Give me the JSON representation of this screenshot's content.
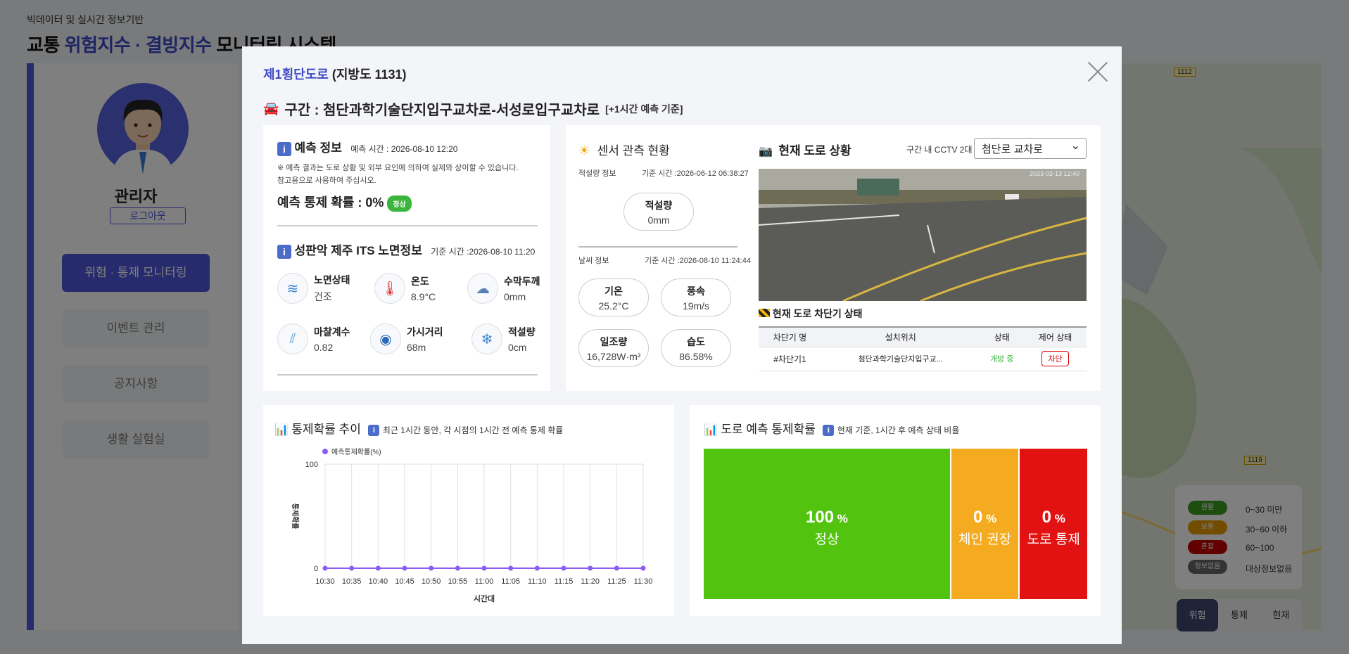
{
  "header": {
    "subtitle": "빅데이터 및 실시간 정보기반",
    "title_pre": "교통 ",
    "title_hl": "위험지수 · 결빙지수",
    "title_post": " 모니터링 시스템"
  },
  "sidebar": {
    "user": "관리자",
    "logout": "로그아웃",
    "menu": [
      "위험 · 통제 모니터링",
      "이벤트 관리",
      "공지사항",
      "생활 실험실"
    ]
  },
  "map": {
    "labels": [
      "1112",
      "1119"
    ],
    "legend": [
      {
        "tag": "원활",
        "text": "0~30 미만",
        "color": "#3a9a1e"
      },
      {
        "tag": "보통",
        "text": "30~60 이하",
        "color": "#e59a00"
      },
      {
        "tag": "혼잡",
        "text": "60~100",
        "color": "#c50000"
      },
      {
        "tag": "정보없음",
        "text": "대상정보없음",
        "color": "#666666"
      }
    ],
    "tabs": [
      "위험",
      "통제",
      "현재"
    ]
  },
  "modal": {
    "road_name": "제1횡단도로",
    "road_code": "(지방도 1131)",
    "section_label": "구간 : 첨단과학기술단지입구교차로-서성로입구교차로",
    "section_suffix": "[+1시간 예측 기준]",
    "forecast": {
      "title": "예측 정보",
      "time": "예측 시간 : 2026-08-10 12:20",
      "note1": "※ 예측 결과는 도로 상황 및 외부 요인에 의하여 실제와 상이할 수 있습니다.",
      "note2": "참고용으로 사용하여 주십시오.",
      "prob_label": "예측 통제 확률 : ",
      "prob_value": "0%",
      "badge": "정상"
    },
    "its": {
      "title": "성판악 제주 ITS 노면정보",
      "time": "기준 시간 :2026-08-10 11:20",
      "items": [
        {
          "label": "노면상태",
          "value": "건조",
          "icon": "wind-icon"
        },
        {
          "label": "온도",
          "value": "8.9°C",
          "icon": "thermometer-icon"
        },
        {
          "label": "수막두께",
          "value": "0mm",
          "icon": "rain-cloud-icon"
        },
        {
          "label": "마찰계수",
          "value": "0.82",
          "icon": "friction-icon"
        },
        {
          "label": "가시거리",
          "value": "68m",
          "icon": "eye-icon"
        },
        {
          "label": "적설량",
          "value": "0cm",
          "icon": "snow-cloud-icon"
        }
      ]
    },
    "sensor": {
      "title": "센서 관측 현황",
      "snow_info": "적설량 정보",
      "snow_time": "기준 시간 :2026-06-12 06:38:27",
      "snow_label": "적설량",
      "snow_value": "0mm",
      "weather_info": "날씨 정보",
      "weather_time": "기준 시간 :2026-08-10 11:24:44",
      "weather": [
        {
          "label": "기온",
          "value": "25.2°C"
        },
        {
          "label": "풍속",
          "value": "19m/s"
        },
        {
          "label": "일조량",
          "value": "16,728W·m²"
        },
        {
          "label": "습도",
          "value": "86.58%"
        }
      ]
    },
    "road": {
      "title": "현재 도로 상황",
      "cctv_count": "구간 내 CCTV 2대",
      "cctv_select": "첨단로 교차로",
      "cctv_timestamp": "2023-02-13 12:40",
      "barrier_title": "현재 도로 차단기 상태",
      "columns": [
        "차단기 명",
        "설치위치",
        "상태",
        "제어 상태"
      ],
      "rows": [
        {
          "name": "#차단기1",
          "location": "첨단과학기술단지입구교...",
          "status": "개방 중",
          "control": "차단"
        }
      ]
    },
    "trend": {
      "title": "통제확률 추이",
      "desc": "최근 1시간 동안, 각 시점의 1시간 전 예측 통제 확률"
    },
    "predict": {
      "title": "도로 예측 통제확률",
      "desc": "현재 기준, 1시간 후 예측 상태 비율",
      "bars": [
        {
          "pct": "100",
          "unit": "%",
          "label": "정상",
          "color": "#52c40f",
          "share": 64.2
        },
        {
          "pct": "0",
          "unit": "%",
          "label": "체인 권장",
          "color": "#f5ab1f",
          "share": 17.9
        },
        {
          "pct": "0",
          "unit": "%",
          "label": "도로 통제",
          "color": "#e31212",
          "share": 17.9
        }
      ]
    }
  },
  "chart_data": {
    "type": "line",
    "title": "",
    "legend": "예측통제확률(%)",
    "xlabel": "시간대",
    "ylabel": "통제확률",
    "ylim": [
      0,
      100
    ],
    "yticks": [
      0,
      100
    ],
    "x": [
      "10:30",
      "10:35",
      "10:40",
      "10:45",
      "10:50",
      "10:55",
      "11:00",
      "11:05",
      "11:10",
      "11:15",
      "11:20",
      "11:25",
      "11:30"
    ],
    "series": [
      {
        "name": "예측통제확률(%)",
        "color": "#8b5cf6",
        "values": [
          0,
          0,
          0,
          0,
          0,
          0,
          0,
          0,
          0,
          0,
          0,
          0,
          0
        ]
      }
    ]
  }
}
